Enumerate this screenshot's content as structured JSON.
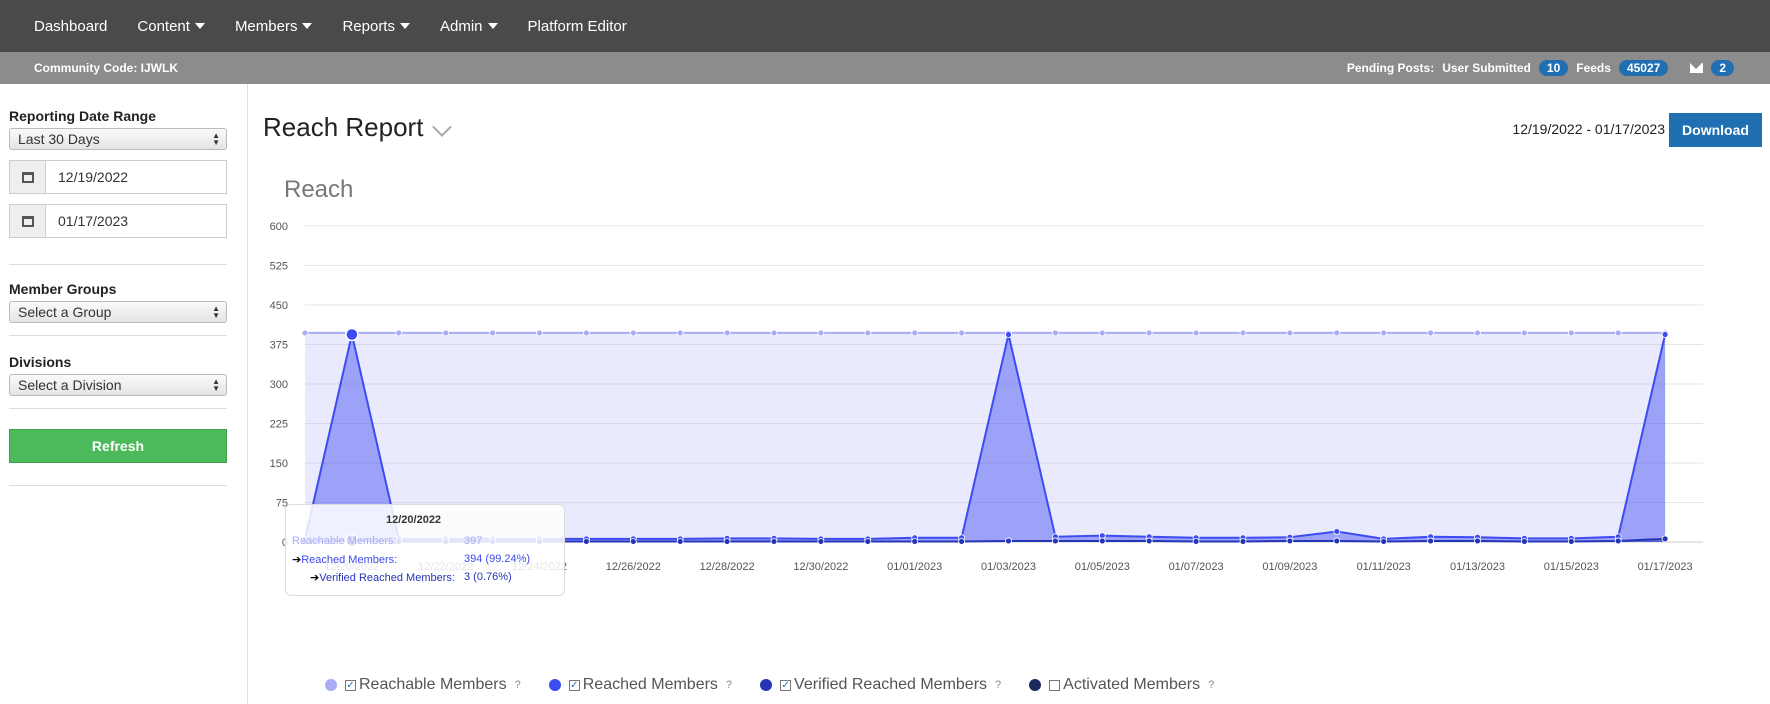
{
  "nav": {
    "items": [
      {
        "label": "Dashboard",
        "caret": false
      },
      {
        "label": "Content",
        "caret": true
      },
      {
        "label": "Members",
        "caret": true
      },
      {
        "label": "Reports",
        "caret": true
      },
      {
        "label": "Admin",
        "caret": true
      },
      {
        "label": "Platform Editor",
        "caret": false
      }
    ]
  },
  "subbar": {
    "community_code": "Community Code: IJWLK",
    "pending_label": "Pending Posts:",
    "user_submitted_label": "User Submitted",
    "user_submitted_count": "10",
    "feeds_label": "Feeds",
    "feeds_count": "45027",
    "messages_count": "2"
  },
  "sidebar": {
    "date_range_label": "Reporting Date Range",
    "date_range_value": "Last 30 Days",
    "start_date": "12/19/2022",
    "end_date": "01/17/2023",
    "member_groups_label": "Member Groups",
    "member_groups_value": "Select a Group",
    "divisions_label": "Divisions",
    "divisions_value": "Select a Division",
    "refresh_label": "Refresh"
  },
  "main": {
    "title": "Reach Report",
    "date_range": "12/19/2022 - 01/17/2023",
    "download_label": "Download",
    "chart_title": "Reach"
  },
  "tooltip": {
    "date": "12/20/2022",
    "reachable_label": "Reachable Members:",
    "reachable_value": "397",
    "reached_label": "Reached Members:",
    "reached_value": "394 (99.24%)",
    "verified_label": "Verified Reached Members:",
    "verified_value": "3 (0.76%)"
  },
  "legend": [
    {
      "label": "Reachable Members",
      "checked": true,
      "color": "#a8acf7"
    },
    {
      "label": "Reached Members",
      "checked": true,
      "color": "#3d4cf0"
    },
    {
      "label": "Verified Reached Members",
      "checked": true,
      "color": "#2535b8"
    },
    {
      "label": "Activated Members",
      "checked": false,
      "color": "#1b2a5e"
    }
  ],
  "chart_data": {
    "type": "area",
    "title": "Reach",
    "ylim": [
      0,
      600
    ],
    "yticks": [
      0,
      75,
      150,
      225,
      300,
      375,
      450,
      525,
      600
    ],
    "x": [
      "12/19/2022",
      "12/20/2022",
      "12/21/2022",
      "12/22/2022",
      "12/23/2022",
      "12/24/2022",
      "12/25/2022",
      "12/26/2022",
      "12/27/2022",
      "12/28/2022",
      "12/29/2022",
      "12/30/2022",
      "12/31/2022",
      "01/01/2023",
      "01/02/2023",
      "01/03/2023",
      "01/04/2023",
      "01/05/2023",
      "01/06/2023",
      "01/07/2023",
      "01/08/2023",
      "01/09/2023",
      "01/10/2023",
      "01/11/2023",
      "01/12/2023",
      "01/13/2023",
      "01/14/2023",
      "01/15/2023",
      "01/16/2023",
      "01/17/2023"
    ],
    "xtick_labels": [
      "12/20/2022",
      "12/22/2022",
      "12/24/2022",
      "12/26/2022",
      "12/28/2022",
      "12/30/2022",
      "01/01/2023",
      "01/03/2023",
      "01/05/2023",
      "01/07/2023",
      "01/09/2023",
      "01/11/2023",
      "01/13/2023",
      "01/15/2023",
      "01/17/2023"
    ],
    "series": [
      {
        "name": "Reachable Members",
        "values": [
          397,
          397,
          397,
          397,
          397,
          397,
          397,
          397,
          397,
          397,
          397,
          397,
          397,
          397,
          397,
          397,
          397,
          397,
          397,
          397,
          397,
          397,
          397,
          397,
          397,
          397,
          397,
          397,
          397,
          397
        ]
      },
      {
        "name": "Reached Members",
        "values": [
          5,
          394,
          6,
          6,
          6,
          6,
          6,
          6,
          6,
          7,
          7,
          6,
          6,
          8,
          8,
          394,
          10,
          12,
          10,
          8,
          8,
          9,
          20,
          6,
          10,
          9,
          7,
          7,
          10,
          394
        ]
      },
      {
        "name": "Verified Reached Members",
        "values": [
          1,
          3,
          1,
          1,
          1,
          1,
          1,
          1,
          1,
          1,
          1,
          1,
          1,
          1,
          1,
          2,
          2,
          2,
          2,
          1,
          1,
          2,
          2,
          1,
          2,
          2,
          1,
          1,
          2,
          6
        ]
      },
      {
        "name": "Activated Members",
        "values": []
      }
    ],
    "grid": true,
    "legend": "bottom"
  }
}
